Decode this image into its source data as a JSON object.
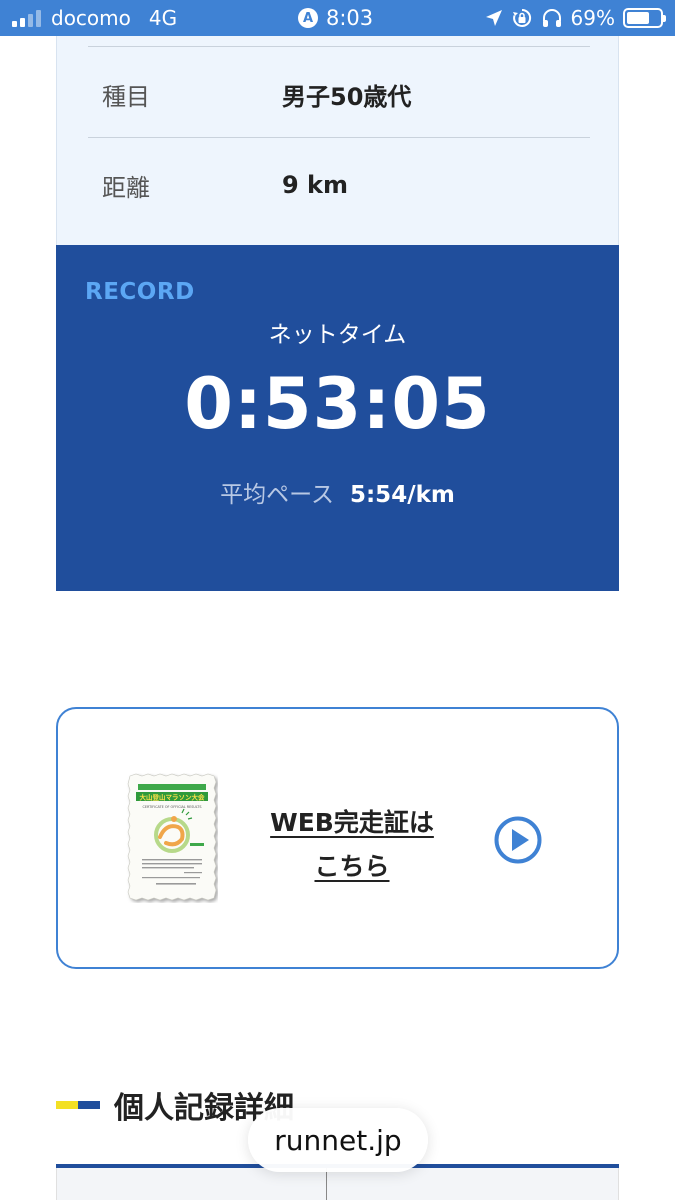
{
  "status_bar": {
    "carrier": "docomo",
    "network": "4G",
    "time": "8:03",
    "location_badge": "A",
    "battery_percent": "69%",
    "battery_level": 0.69,
    "icons": [
      "signal-icon",
      "location-arrow-icon",
      "rotation-lock-icon",
      "headphones-icon",
      "battery-icon"
    ]
  },
  "info": {
    "rows": [
      {
        "label": "種目",
        "value": "男子50歳代"
      },
      {
        "label": "距離",
        "value": "9 km"
      }
    ]
  },
  "record": {
    "heading": "RECORD",
    "net_time_label": "ネットタイム",
    "net_time": "0:53:05",
    "pace_label": "平均ペース",
    "pace_value": "5:54/km"
  },
  "certificate": {
    "link_line1": "WEB完走証は",
    "link_line2": "こちら",
    "thumb_title": "大山登山マラソン大会",
    "thumb_subtitle": "CERTIFICATE OF OFFICIAL RESULTS",
    "play_icon": "play-circle-icon"
  },
  "section": {
    "title": "個人記録詳細"
  },
  "browser": {
    "url": "runnet.jp"
  },
  "colors": {
    "status_bar": "#3f82d4",
    "record_bg": "#204e9c",
    "record_label": "#5ca7f4",
    "info_bg": "#eef5fd",
    "accent_yellow": "#f3e024"
  }
}
